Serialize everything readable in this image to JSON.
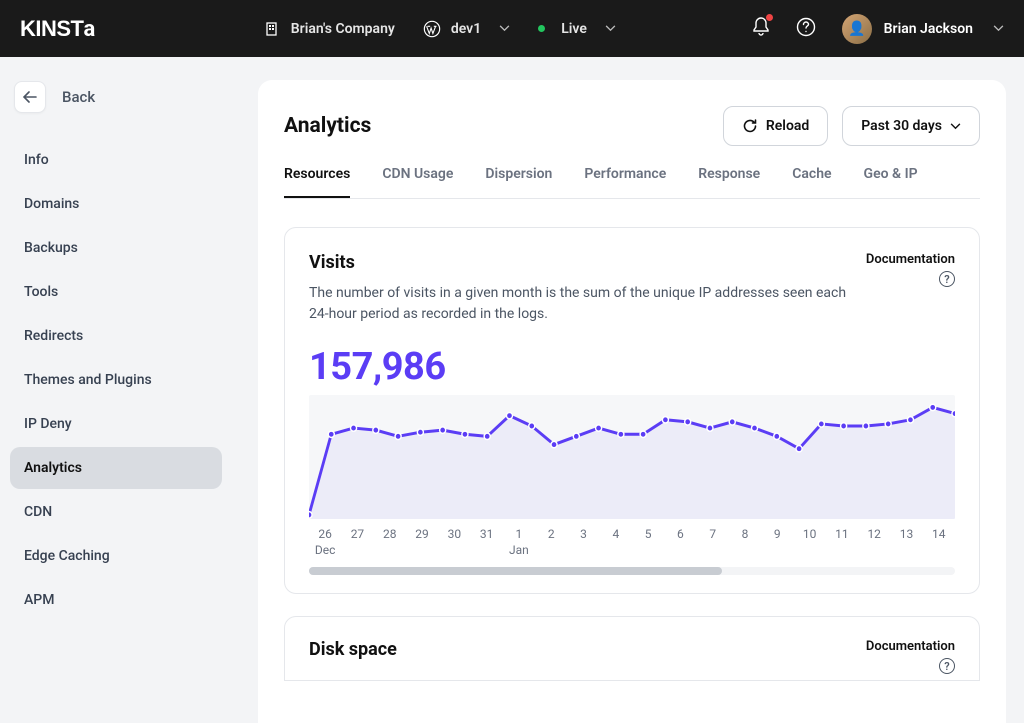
{
  "header": {
    "logo": "KINSTA",
    "company": "Brian's Company",
    "site": "dev1",
    "env": "Live",
    "user": "Brian Jackson"
  },
  "sidebar": {
    "back": "Back",
    "items": [
      {
        "label": "Info"
      },
      {
        "label": "Domains"
      },
      {
        "label": "Backups"
      },
      {
        "label": "Tools"
      },
      {
        "label": "Redirects"
      },
      {
        "label": "Themes and Plugins"
      },
      {
        "label": "IP Deny"
      },
      {
        "label": "Analytics",
        "active": true
      },
      {
        "label": "CDN"
      },
      {
        "label": "Edge Caching"
      },
      {
        "label": "APM"
      }
    ]
  },
  "page": {
    "title": "Analytics",
    "reload": "Reload",
    "range": "Past 30 days",
    "tabs": [
      "Resources",
      "CDN Usage",
      "Dispersion",
      "Performance",
      "Response",
      "Cache",
      "Geo & IP"
    ],
    "active_tab": 0
  },
  "visits_card": {
    "title": "Visits",
    "desc": "The number of visits in a given month is the sum of the unique IP addresses seen each 24-hour period as recorded in the logs.",
    "doc_label": "Documentation",
    "value": "157,986"
  },
  "disk_card": {
    "title": "Disk space",
    "doc_label": "Documentation"
  },
  "chart_data": {
    "type": "line",
    "title": "Visits",
    "xlabel": "",
    "ylabel": "",
    "x_ticks": [
      {
        "label": "26",
        "sub": "Dec"
      },
      {
        "label": "27"
      },
      {
        "label": "28"
      },
      {
        "label": "29"
      },
      {
        "label": "30"
      },
      {
        "label": "31"
      },
      {
        "label": "1",
        "sub": "Jan"
      },
      {
        "label": "2"
      },
      {
        "label": "3"
      },
      {
        "label": "4"
      },
      {
        "label": "5"
      },
      {
        "label": "6"
      },
      {
        "label": "7"
      },
      {
        "label": "8"
      },
      {
        "label": "9"
      },
      {
        "label": "10"
      },
      {
        "label": "11"
      },
      {
        "label": "12"
      },
      {
        "label": "13"
      },
      {
        "label": "14"
      }
    ],
    "series": [
      {
        "name": "Visits",
        "color": "#5b3df5",
        "values": [
          3100,
          5050,
          5200,
          5150,
          5000,
          5100,
          5150,
          5050,
          5000,
          5500,
          5250,
          4800,
          5000,
          5200,
          5050,
          5050,
          5400,
          5350,
          5200,
          5350,
          5200,
          5000,
          4700,
          5300,
          5250,
          5250,
          5300,
          5400,
          5700,
          5550
        ]
      }
    ],
    "ylim": [
      3000,
      6000
    ]
  }
}
